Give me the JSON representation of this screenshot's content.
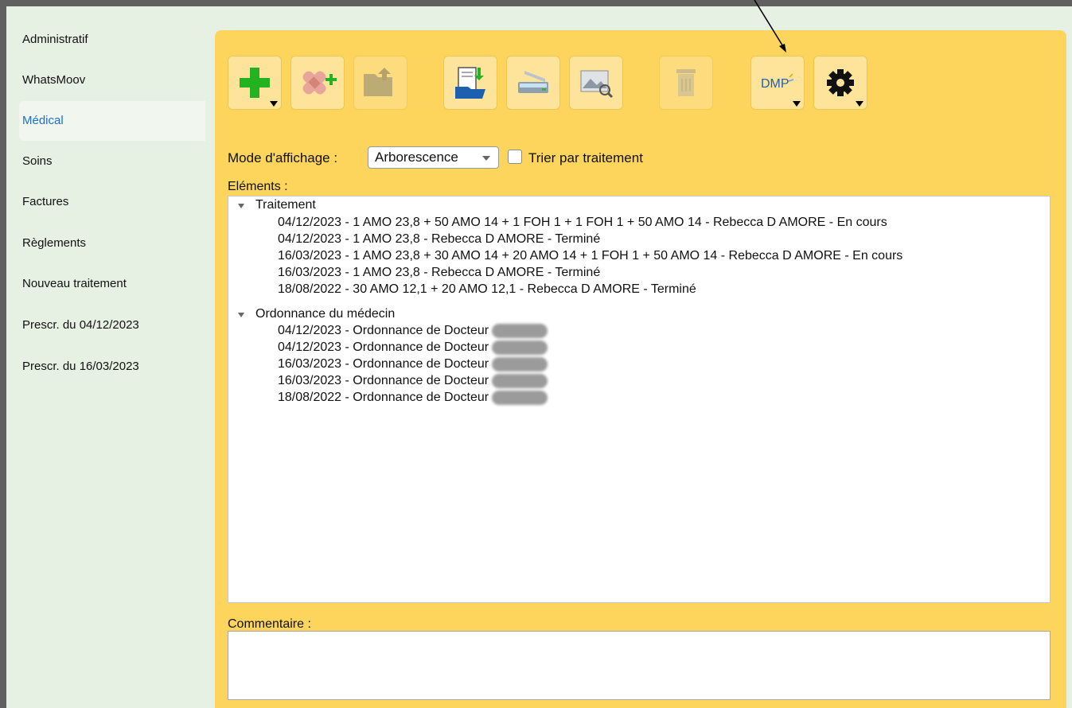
{
  "sidebar": {
    "items": [
      {
        "label": "Administratif"
      },
      {
        "label": "WhatsMoov"
      },
      {
        "label": "Médical",
        "active": true
      },
      {
        "label": "Soins"
      },
      {
        "label": "Factures"
      },
      {
        "label": "Règlements"
      },
      {
        "label": "Nouveau traitement"
      },
      {
        "label": "Prescr. du 04/12/2023"
      },
      {
        "label": "Prescr. du 16/03/2023"
      }
    ]
  },
  "toolbar": {
    "buttons": [
      {
        "icon": "add-plus-icon"
      },
      {
        "icon": "add-care-bandage-icon"
      },
      {
        "icon": "open-folder-icon"
      },
      {
        "icon": "import-document-icon"
      },
      {
        "icon": "scanner-icon"
      },
      {
        "icon": "image-preview-icon"
      },
      {
        "icon": "trash-icon",
        "disabled": true
      },
      {
        "icon": "dmp-icon",
        "label": "DMP"
      },
      {
        "icon": "settings-gear-icon"
      }
    ]
  },
  "display": {
    "mode_label": "Mode d'affichage :",
    "mode_value": "Arborescence",
    "sort_label": "Trier par traitement",
    "sort_checked": false
  },
  "elements": {
    "label": "Eléments :",
    "groups": [
      {
        "title": "Traitement",
        "items": [
          "04/12/2023 - 1 AMO 23,8 + 50 AMO 14 + 1 FOH 1 + 1 FOH 1 + 50 AMO 14 - Rebecca D AMORE - En cours",
          "04/12/2023 - 1 AMO 23,8 - Rebecca D AMORE - Terminé",
          "16/03/2023 - 1 AMO 23,8 + 30 AMO 14 + 20 AMO 14 + 1 FOH 1 + 50 AMO 14 - Rebecca D AMORE - En cours",
          "16/03/2023 - 1 AMO 23,8 - Rebecca D AMORE - Terminé",
          "18/08/2022 - 30 AMO 12,1 + 20 AMO 12,1 - Rebecca D AMORE - Terminé"
        ]
      },
      {
        "title": "Ordonnance du médecin",
        "items": [
          "04/12/2023 - Ordonnance de Docteur",
          "04/12/2023 - Ordonnance de Docteur",
          "16/03/2023 - Ordonnance de Docteur",
          "16/03/2023 - Ordonnance de Docteur",
          "18/08/2022 - Ordonnance de Docteur"
        ]
      }
    ]
  },
  "comment": {
    "label": "Commentaire :",
    "value": ""
  },
  "colors": {
    "panel": "#fdd45c",
    "sidebar": "#e6f1e4",
    "accent": "#1c6fd1",
    "button": "#fde49a"
  }
}
